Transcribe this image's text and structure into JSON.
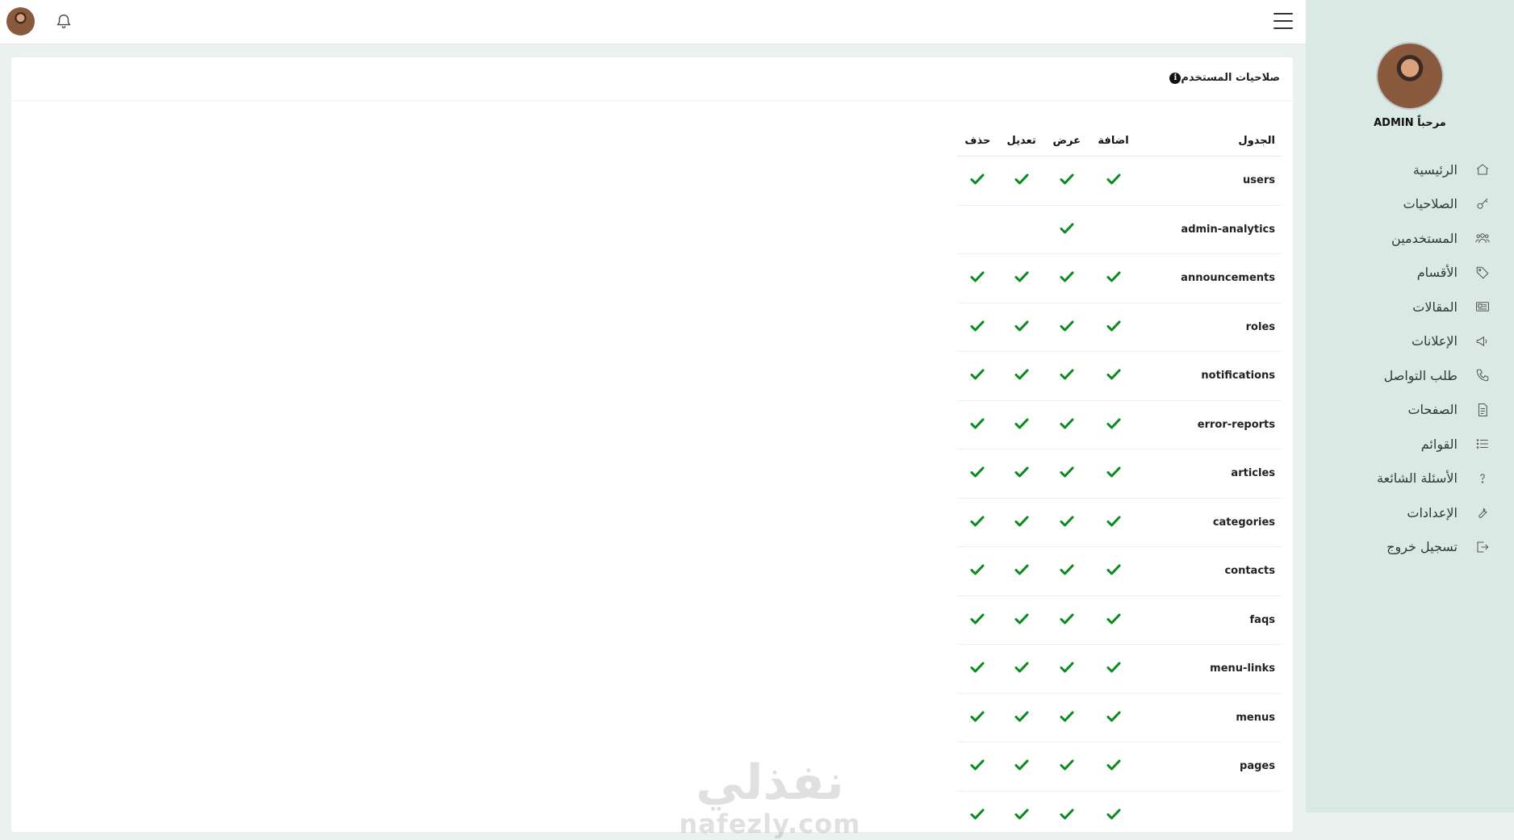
{
  "sidebar": {
    "welcome": "مرحباً ADMIN",
    "items": [
      {
        "label": "الرئيسية",
        "icon": "home-icon"
      },
      {
        "label": "الصلاحيات",
        "icon": "key-icon"
      },
      {
        "label": "المستخدمين",
        "icon": "users-icon"
      },
      {
        "label": "الأقسام",
        "icon": "tag-icon"
      },
      {
        "label": "المقالات",
        "icon": "newspaper-icon"
      },
      {
        "label": "الإعلانات",
        "icon": "megaphone-icon"
      },
      {
        "label": "طلب التواصل",
        "icon": "phone-icon"
      },
      {
        "label": "الصفحات",
        "icon": "file-icon"
      },
      {
        "label": "القوائم",
        "icon": "list-icon"
      },
      {
        "label": "الأسئلة الشائعة",
        "icon": "question-icon"
      },
      {
        "label": "الإعدادات",
        "icon": "wrench-icon"
      },
      {
        "label": "تسجيل خروج",
        "icon": "logout-icon"
      }
    ]
  },
  "card": {
    "title": "صلاحيات المستخدم",
    "info_symbol": "i"
  },
  "table": {
    "headers": {
      "table": "الجدول",
      "add": "اضافة",
      "view": "عرض",
      "edit": "تعديل",
      "delete": "حذف"
    },
    "rows": [
      {
        "name": "users",
        "add": true,
        "view": true,
        "edit": true,
        "delete": true
      },
      {
        "name": "admin-analytics",
        "add": false,
        "view": true,
        "edit": false,
        "delete": false
      },
      {
        "name": "announcements",
        "add": true,
        "view": true,
        "edit": true,
        "delete": true
      },
      {
        "name": "roles",
        "add": true,
        "view": true,
        "edit": true,
        "delete": true
      },
      {
        "name": "notifications",
        "add": true,
        "view": true,
        "edit": true,
        "delete": true
      },
      {
        "name": "error-reports",
        "add": true,
        "view": true,
        "edit": true,
        "delete": true
      },
      {
        "name": "articles",
        "add": true,
        "view": true,
        "edit": true,
        "delete": true
      },
      {
        "name": "categories",
        "add": true,
        "view": true,
        "edit": true,
        "delete": true
      },
      {
        "name": "contacts",
        "add": true,
        "view": true,
        "edit": true,
        "delete": true
      },
      {
        "name": "faqs",
        "add": true,
        "view": true,
        "edit": true,
        "delete": true
      },
      {
        "name": "menu-links",
        "add": true,
        "view": true,
        "edit": true,
        "delete": true
      },
      {
        "name": "menus",
        "add": true,
        "view": true,
        "edit": true,
        "delete": true
      },
      {
        "name": "pages",
        "add": true,
        "view": true,
        "edit": true,
        "delete": true
      },
      {
        "name": "",
        "add": true,
        "view": true,
        "edit": true,
        "delete": true
      }
    ]
  },
  "watermark": {
    "arabic": "نفذلي",
    "latin": "nafezly.com"
  },
  "colors": {
    "check": "#0a8a1f",
    "sidebar_bg": "#dbe9e5",
    "page_bg": "#eaf1ef"
  }
}
